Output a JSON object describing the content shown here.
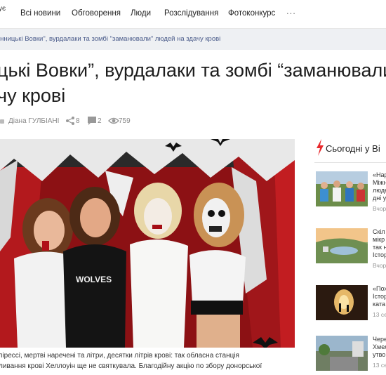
{
  "nav": {
    "cut_label": "ує",
    "items": [
      "Всі новини",
      "Обговорення",
      "Люди",
      "Розслідування",
      "Фотоконкурс"
    ],
    "more": "..."
  },
  "breadcrumb": "інницькі Вовки\", вурдалаки та зомбі \"заманювали\" людей на здачу крові",
  "article": {
    "title_line1": "цькі Вовки”, вурдалаки та зомбі “заманювали",
    "title_line2": "чу крові",
    "author": "Діана ГУЛБІАНІ",
    "shares": "8",
    "comments": "2",
    "views": "759",
    "caption_line1": "пірессі, мертві наречені та літри, десятки літрів крові: так обласна станція",
    "caption_line2": "ливання крові Хеллоуін ще не святкувала. Благодійну акцію по збору донорської",
    "shirt_text": "WOLVES"
  },
  "sidebar": {
    "heading": "Сьогодні у Ві",
    "news": [
      {
        "line1": "«Нар",
        "line2": "Міжн",
        "line3": "люде",
        "line4": "дні у",
        "date": "Вчор"
      },
      {
        "line1": "Скіл",
        "line2": "мікр",
        "line3": "так н",
        "line4": "Істор",
        "date": "Вчор"
      },
      {
        "line1": "«Пох",
        "line2": "Істор",
        "line3": "ката",
        "line4": "",
        "date": "13 се"
      },
      {
        "line1": "Чере",
        "line2": "Хмел",
        "line3": "утво",
        "line4": "",
        "date": "13 се"
      }
    ]
  },
  "colors": {
    "accent_red": "#e8292c",
    "breadcrumb_bg": "#eef0f3",
    "link_blue": "#4a5b8a"
  }
}
